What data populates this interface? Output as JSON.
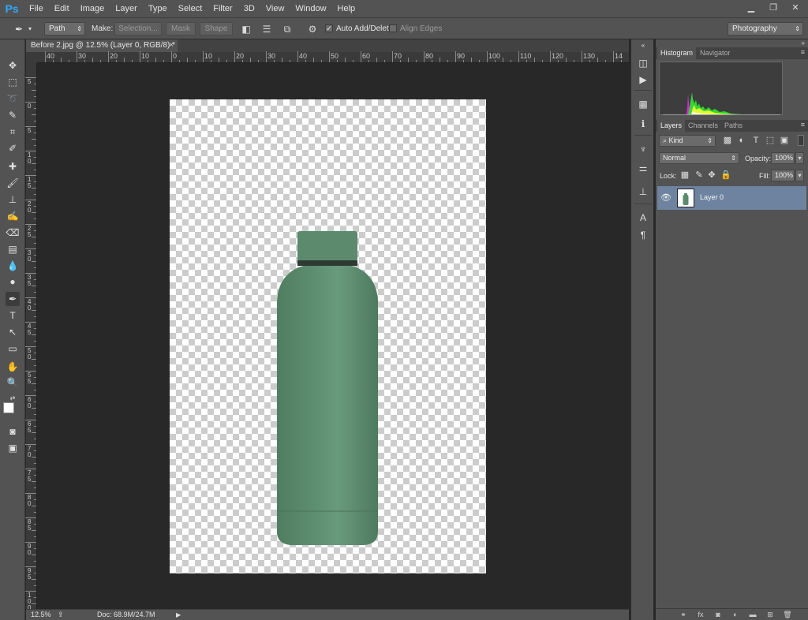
{
  "app": {
    "logo": "Ps"
  },
  "menu": [
    "File",
    "Edit",
    "Image",
    "Layer",
    "Type",
    "Select",
    "Filter",
    "3D",
    "View",
    "Window",
    "Help"
  ],
  "window_controls": {
    "minimize": "▁",
    "restore": "❐",
    "close": "✕"
  },
  "options": {
    "mode": "Path",
    "make_label": "Make:",
    "selection_btn": "Selection...",
    "mask_btn": "Mask",
    "shape_btn": "Shape",
    "auto_add_label": "Auto Add/Delete",
    "auto_add_checked": "✓",
    "align_edges_label": "Align Edges",
    "workspace": "Photography"
  },
  "document": {
    "tab_title": "Before 2.jpg @ 12.5% (Layer 0, RGB/8) *",
    "close": "×",
    "zoom": "12.5%",
    "doc_info": "Doc: 68.9M/24.7M",
    "hruler_labels": [
      "40",
      "30",
      "20",
      "10",
      "0",
      "10",
      "20",
      "30",
      "40",
      "50",
      "60",
      "70",
      "80",
      "90",
      "100",
      "110",
      "120",
      "130",
      "14"
    ],
    "vruler_labels": [
      "5",
      "0",
      "5",
      "1 0",
      "1 5",
      "2 0",
      "2 5",
      "3 0",
      "3 5",
      "4 0",
      "4 5",
      "5 0",
      "5 5",
      "6 0",
      "6 5",
      "7 0",
      "7 5",
      "8 0",
      "8 5",
      "9 0",
      "9 5",
      "1 0 0"
    ]
  },
  "panels": {
    "top_tabs": [
      "Histogram",
      "Navigator"
    ],
    "layer_tabs": [
      "Layers",
      "Channels",
      "Paths"
    ],
    "kind_label": "Kind",
    "blend_mode": "Normal",
    "opacity_label": "Opacity:",
    "opacity_value": "100%",
    "lock_label": "Lock:",
    "fill_label": "Fill:",
    "fill_value": "100%",
    "layer_name": "Layer 0"
  },
  "colors": {
    "accent_logo": "#31a8ff",
    "layer_selected": "#6e83a0",
    "bottle": "#5a8a6c"
  }
}
